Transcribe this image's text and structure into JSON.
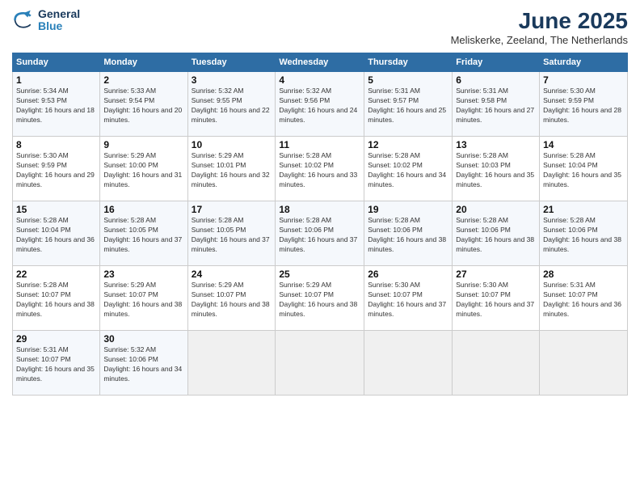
{
  "logo": {
    "line1": "General",
    "line2": "Blue"
  },
  "title": "June 2025",
  "location": "Meliskerke, Zeeland, The Netherlands",
  "headers": [
    "Sunday",
    "Monday",
    "Tuesday",
    "Wednesday",
    "Thursday",
    "Friday",
    "Saturday"
  ],
  "weeks": [
    [
      {
        "day": "1",
        "sunrise": "5:34 AM",
        "sunset": "9:53 PM",
        "daylight": "16 hours and 18 minutes."
      },
      {
        "day": "2",
        "sunrise": "5:33 AM",
        "sunset": "9:54 PM",
        "daylight": "16 hours and 20 minutes."
      },
      {
        "day": "3",
        "sunrise": "5:32 AM",
        "sunset": "9:55 PM",
        "daylight": "16 hours and 22 minutes."
      },
      {
        "day": "4",
        "sunrise": "5:32 AM",
        "sunset": "9:56 PM",
        "daylight": "16 hours and 24 minutes."
      },
      {
        "day": "5",
        "sunrise": "5:31 AM",
        "sunset": "9:57 PM",
        "daylight": "16 hours and 25 minutes."
      },
      {
        "day": "6",
        "sunrise": "5:31 AM",
        "sunset": "9:58 PM",
        "daylight": "16 hours and 27 minutes."
      },
      {
        "day": "7",
        "sunrise": "5:30 AM",
        "sunset": "9:59 PM",
        "daylight": "16 hours and 28 minutes."
      }
    ],
    [
      {
        "day": "8",
        "sunrise": "5:30 AM",
        "sunset": "9:59 PM",
        "daylight": "16 hours and 29 minutes."
      },
      {
        "day": "9",
        "sunrise": "5:29 AM",
        "sunset": "10:00 PM",
        "daylight": "16 hours and 31 minutes."
      },
      {
        "day": "10",
        "sunrise": "5:29 AM",
        "sunset": "10:01 PM",
        "daylight": "16 hours and 32 minutes."
      },
      {
        "day": "11",
        "sunrise": "5:28 AM",
        "sunset": "10:02 PM",
        "daylight": "16 hours and 33 minutes."
      },
      {
        "day": "12",
        "sunrise": "5:28 AM",
        "sunset": "10:02 PM",
        "daylight": "16 hours and 34 minutes."
      },
      {
        "day": "13",
        "sunrise": "5:28 AM",
        "sunset": "10:03 PM",
        "daylight": "16 hours and 35 minutes."
      },
      {
        "day": "14",
        "sunrise": "5:28 AM",
        "sunset": "10:04 PM",
        "daylight": "16 hours and 35 minutes."
      }
    ],
    [
      {
        "day": "15",
        "sunrise": "5:28 AM",
        "sunset": "10:04 PM",
        "daylight": "16 hours and 36 minutes."
      },
      {
        "day": "16",
        "sunrise": "5:28 AM",
        "sunset": "10:05 PM",
        "daylight": "16 hours and 37 minutes."
      },
      {
        "day": "17",
        "sunrise": "5:28 AM",
        "sunset": "10:05 PM",
        "daylight": "16 hours and 37 minutes."
      },
      {
        "day": "18",
        "sunrise": "5:28 AM",
        "sunset": "10:06 PM",
        "daylight": "16 hours and 37 minutes."
      },
      {
        "day": "19",
        "sunrise": "5:28 AM",
        "sunset": "10:06 PM",
        "daylight": "16 hours and 38 minutes."
      },
      {
        "day": "20",
        "sunrise": "5:28 AM",
        "sunset": "10:06 PM",
        "daylight": "16 hours and 38 minutes."
      },
      {
        "day": "21",
        "sunrise": "5:28 AM",
        "sunset": "10:06 PM",
        "daylight": "16 hours and 38 minutes."
      }
    ],
    [
      {
        "day": "22",
        "sunrise": "5:28 AM",
        "sunset": "10:07 PM",
        "daylight": "16 hours and 38 minutes."
      },
      {
        "day": "23",
        "sunrise": "5:29 AM",
        "sunset": "10:07 PM",
        "daylight": "16 hours and 38 minutes."
      },
      {
        "day": "24",
        "sunrise": "5:29 AM",
        "sunset": "10:07 PM",
        "daylight": "16 hours and 38 minutes."
      },
      {
        "day": "25",
        "sunrise": "5:29 AM",
        "sunset": "10:07 PM",
        "daylight": "16 hours and 38 minutes."
      },
      {
        "day": "26",
        "sunrise": "5:30 AM",
        "sunset": "10:07 PM",
        "daylight": "16 hours and 37 minutes."
      },
      {
        "day": "27",
        "sunrise": "5:30 AM",
        "sunset": "10:07 PM",
        "daylight": "16 hours and 37 minutes."
      },
      {
        "day": "28",
        "sunrise": "5:31 AM",
        "sunset": "10:07 PM",
        "daylight": "16 hours and 36 minutes."
      }
    ],
    [
      {
        "day": "29",
        "sunrise": "5:31 AM",
        "sunset": "10:07 PM",
        "daylight": "16 hours and 35 minutes."
      },
      {
        "day": "30",
        "sunrise": "5:32 AM",
        "sunset": "10:06 PM",
        "daylight": "16 hours and 34 minutes."
      },
      null,
      null,
      null,
      null,
      null
    ]
  ]
}
